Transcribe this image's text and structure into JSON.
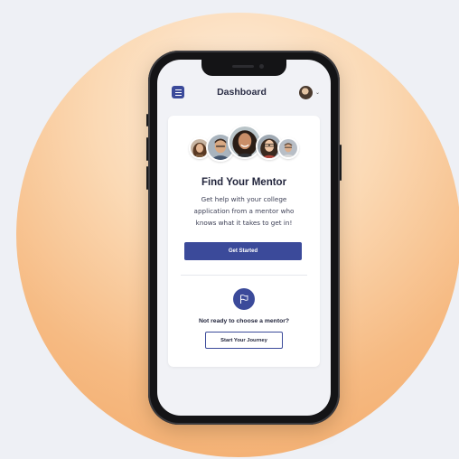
{
  "header": {
    "title": "Dashboard",
    "menu_icon": "hamburger-menu-icon",
    "profile_icon": "avatar",
    "dropdown_icon": "chevron-down-icon"
  },
  "mentor_card": {
    "title": "Find Your Mentor",
    "description_lines": [
      "Get help with your college",
      "application from a mentor who",
      "knows what it takes to get in!"
    ],
    "primary_button": "Get Started"
  },
  "journey": {
    "icon": "flag-icon",
    "prompt": "Not ready to choose a mentor?",
    "button": "Start Your Journey"
  },
  "colors": {
    "accent": "#3b4a9a",
    "background_circle": "#f6ba82"
  }
}
